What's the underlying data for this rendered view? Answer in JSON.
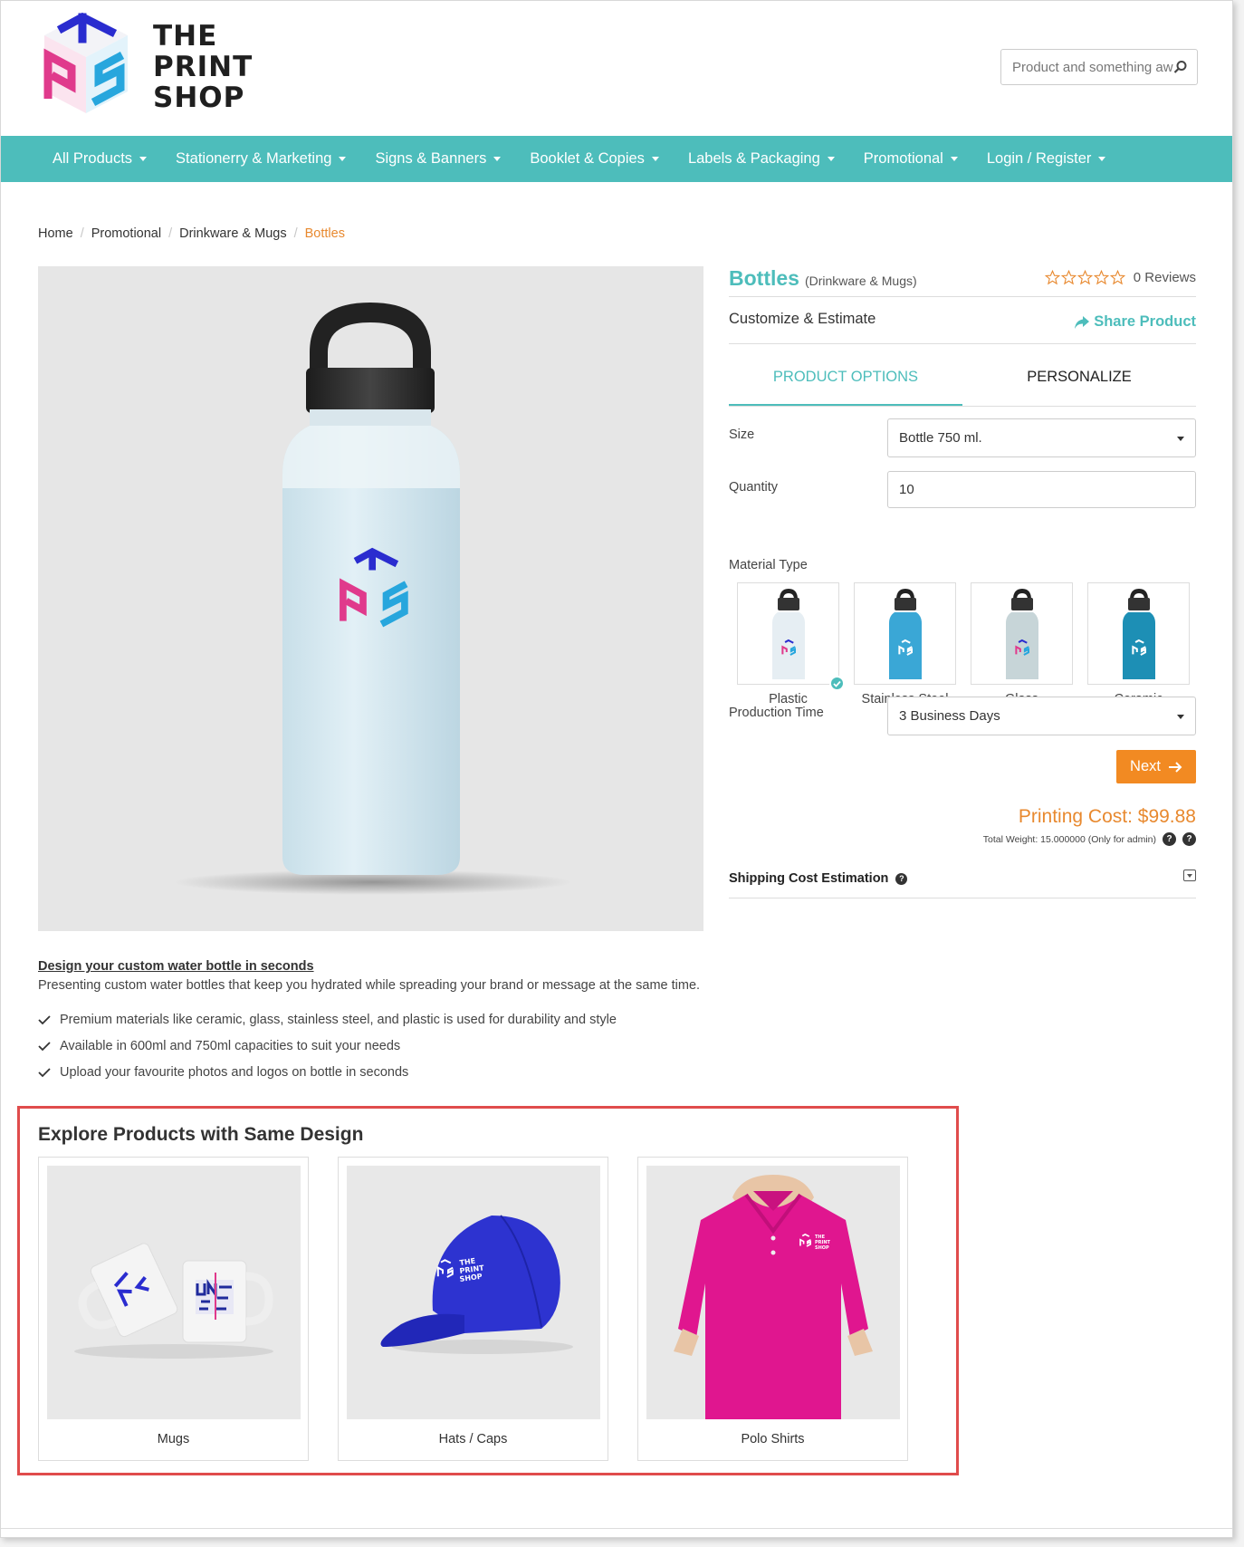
{
  "brand": {
    "logo_line1": "THE",
    "logo_line2": "PRINT",
    "logo_line3": "SHOP",
    "primary_color": "#4dbdbb",
    "accent_color": "#f28a22"
  },
  "search": {
    "placeholder": "Product and something awesome",
    "value": ""
  },
  "nav": [
    {
      "label": "All Products"
    },
    {
      "label": "Stationerry & Marketing"
    },
    {
      "label": "Signs & Banners"
    },
    {
      "label": "Booklet & Copies"
    },
    {
      "label": "Labels & Packaging"
    },
    {
      "label": "Promotional"
    },
    {
      "label": "Login / Register"
    }
  ],
  "breadcrumb": [
    "Home",
    "Promotional",
    "Drinkware & Mugs",
    "Bottles"
  ],
  "product": {
    "title": "Bottles",
    "category": "(Drinkware & Mugs)",
    "rating_stars": 0,
    "reviews": "0 Reviews",
    "customize_label": "Customize & Estimate",
    "share_label": "Share Product"
  },
  "tabs": [
    {
      "label": "PRODUCT OPTIONS",
      "active": true
    },
    {
      "label": "PERSONALIZE",
      "active": false
    }
  ],
  "form": {
    "size_label": "Size",
    "size_value": "Bottle 750 ml.",
    "quantity_label": "Quantity",
    "quantity_value": "10",
    "material_label": "Material Type",
    "materials": [
      {
        "name": "Plastic",
        "selected": true
      },
      {
        "name": "Stainless Steel",
        "selected": false
      },
      {
        "name": "Glass",
        "selected": false
      },
      {
        "name": "Ceramic",
        "selected": false
      }
    ],
    "production_label": "Production Time",
    "production_value": "3 Business Days",
    "next_label": "Next"
  },
  "pricing": {
    "cost": "Printing Cost: $99.88",
    "weight": "Total Weight: 15.000000 (Only for admin)"
  },
  "shipping": {
    "label": "Shipping Cost Estimation"
  },
  "description": {
    "title": "Design your custom water bottle in seconds",
    "text": "Presenting custom water bottles that keep you hydrated while spreading your brand or message at the same time.",
    "bullets": [
      "Premium materials like ceramic, glass, stainless steel, and plastic is used for durability and style",
      "Available in 600ml and 750ml capacities to suit your needs",
      "Upload your favourite photos and logos on bottle in seconds"
    ]
  },
  "explore": {
    "title": "Explore Products with Same Design",
    "products": [
      {
        "name": "Mugs"
      },
      {
        "name": "Hats / Caps"
      },
      {
        "name": "Polo Shirts"
      }
    ]
  }
}
